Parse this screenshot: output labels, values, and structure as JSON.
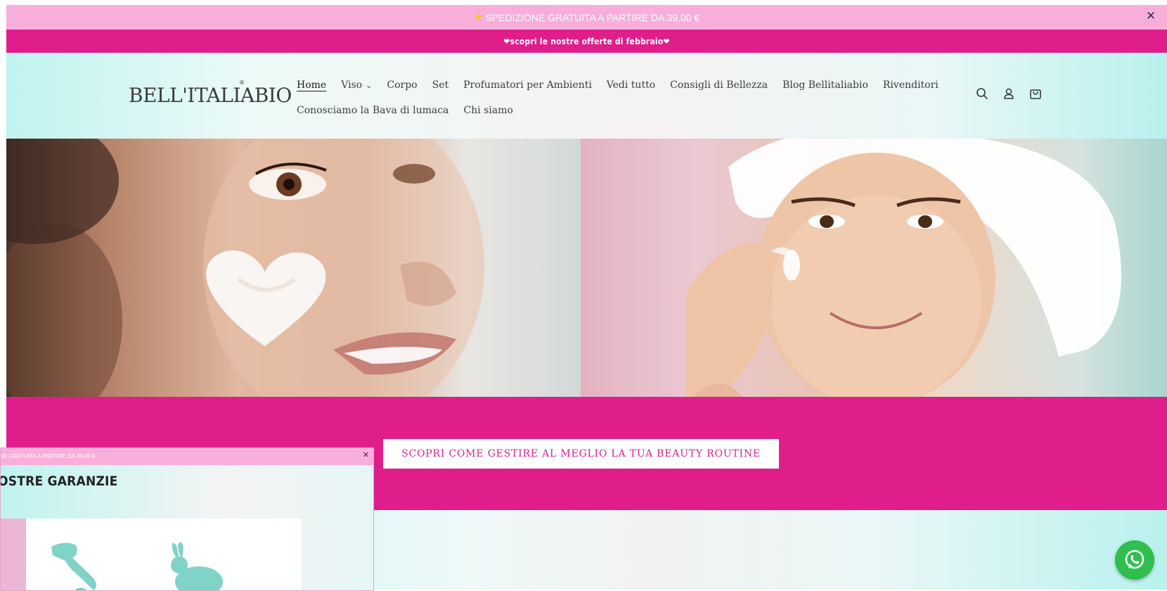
{
  "announcement": {
    "shipping_icon": "star-icon",
    "shipping_text": "SPEDIZIONE GRATUITA A PARTIRE DA 39,00 €",
    "close_label": "✕",
    "offer_text": "❤scopri le nostre offerte di febbraio❤"
  },
  "header": {
    "logo_text": "BELL'ITALIABIO",
    "logo_mark": "®",
    "nav_row1": [
      {
        "label": "Home",
        "active": true
      },
      {
        "label": "Viso",
        "dropdown": true
      },
      {
        "label": "Corpo"
      },
      {
        "label": "Set"
      },
      {
        "label": "Profumatori per Ambienti"
      },
      {
        "label": "Vedi tutto"
      },
      {
        "label": "Consigli di Bellezza"
      },
      {
        "label": "Blog Bellitaliabio"
      },
      {
        "label": "Rivenditori"
      }
    ],
    "nav_row2": [
      {
        "label": "Conosciamo la Bava di lumaca"
      },
      {
        "label": "Chi siamo"
      }
    ],
    "icons": [
      "search-icon",
      "account-icon",
      "cart-icon"
    ]
  },
  "cta": {
    "button_label": "SCOPRI COME GESTIRE AL MEGLIO LA TUA BEAUTY ROUTINE"
  },
  "overlay": {
    "bar_text": "NE GRATUITA A PARTIRE DA 39,00 €",
    "close_label": "✕",
    "title": "OSTRE GARANZIE",
    "card_icons": [
      "italy-map-icon",
      "rabbit-icon"
    ]
  },
  "colors": {
    "pink_light": "#f8aedb",
    "pink_brand": "#e01e8b",
    "mint": "#bff3f0",
    "whatsapp_green": "#2fbf4e",
    "teal_icon": "#7fd3c7"
  },
  "floating": {
    "whatsapp_icon": "whatsapp-icon"
  }
}
